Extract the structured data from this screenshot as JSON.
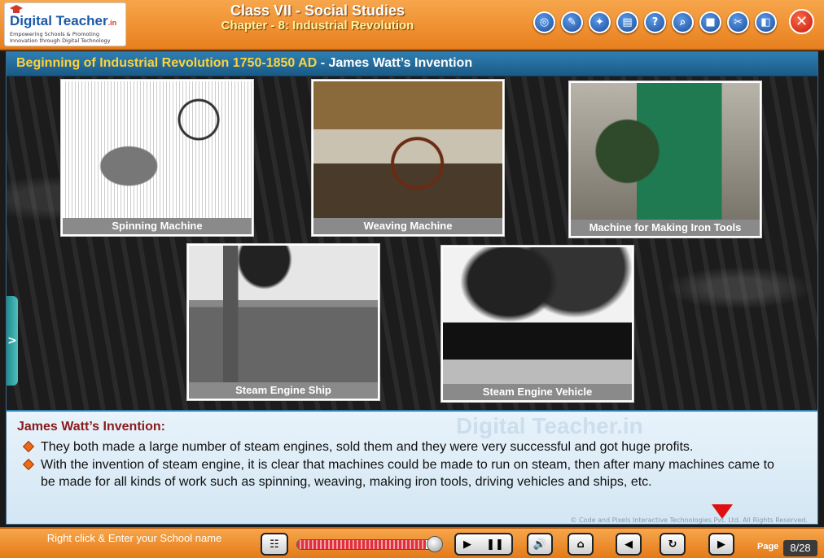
{
  "header": {
    "logo_text": "Digital Teacher",
    "logo_suffix": ".in",
    "logo_tagline": "Empowering Schools & Promoting Innovation through Digital Technology",
    "class_title": "Class VII - Social Studies",
    "chapter_title": "Chapter - 8: Industrial Revolution",
    "toolbar_icons": [
      "gallery-icon",
      "notes-icon",
      "activity-icon",
      "worksheet-icon",
      "help-icon",
      "search-icon",
      "glossary-icon",
      "tools-icon",
      "window-icon"
    ],
    "toolbar_glyphs": [
      "◎",
      "✎",
      "✦",
      "▤",
      "?",
      "⌕",
      "■",
      "✂",
      "◧"
    ],
    "close_glyph": "✕"
  },
  "slide": {
    "title_highlight": "Beginning of Industrial Revolution 1750-1850 AD",
    "title_rest": " - James Watt’s Invention",
    "side_tab_glyph": ">",
    "photos": [
      {
        "caption": "Spinning Machine"
      },
      {
        "caption": "Weaving Machine"
      },
      {
        "caption": "Machine for Making Iron Tools"
      },
      {
        "caption": "Steam Engine Ship"
      },
      {
        "caption": "Steam Engine Vehicle"
      }
    ]
  },
  "panel": {
    "watermark": "Digital Teacher.in",
    "heading": "James Watt’s Invention:",
    "bullets": [
      "They both made a large number of steam engines, sold them and they were very successful and got huge profits.",
      "With the invention of steam engine, it is clear that machines could be made to run on steam, then after many machines came to be made for all kinds of work such as spinning, weaving, making iron tools, driving vehicles and ships, etc."
    ],
    "copyright": "© Code and Pixels Interactive Technologies Pvt. Ltd. All Rights Reserved."
  },
  "footer": {
    "school_prompt": "Right click & Enter your School name",
    "progress_fraction": 0.9,
    "page_label": "Page",
    "page_number": "8/28",
    "glyphs": {
      "menu": "☷",
      "play": "▶",
      "pause": "❚❚",
      "audio": "🔊",
      "home": "⌂",
      "prev": "◀",
      "replay": "↻",
      "next": "▶"
    }
  },
  "colors": {
    "header_orange": "#e8801e",
    "title_blue": "#1a5a86",
    "title_yellow": "#ffd23a",
    "heading_red": "#8a1a1a",
    "bullet_orange": "#e86a1a"
  }
}
